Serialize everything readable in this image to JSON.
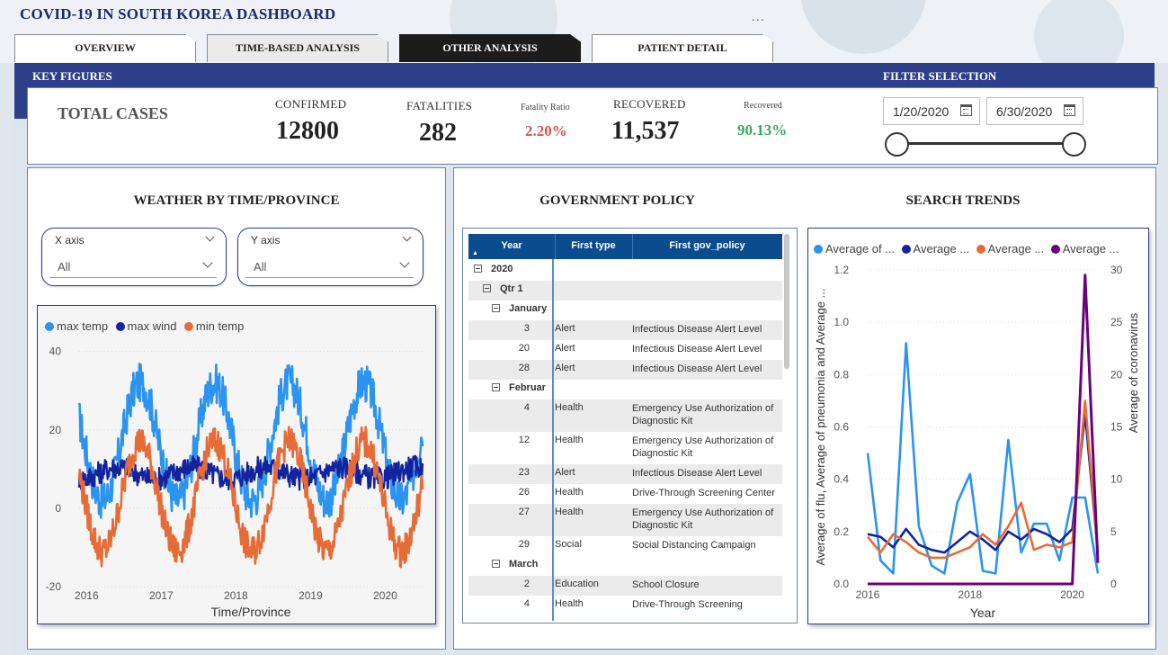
{
  "header": {
    "title": "COVID-19 IN SOUTH KOREA DASHBOARD",
    "more_label": "..."
  },
  "tabs": [
    {
      "label": "OVERVIEW"
    },
    {
      "label": "TIME-BASED ANALYSIS"
    },
    {
      "label": "OTHER ANALYSIS"
    },
    {
      "label": "PATIENT DETAIL"
    }
  ],
  "key_figures": {
    "section_label": "KEY FIGURES",
    "total_label": "TOTAL CASES",
    "confirmed_label": "CONFIRMED",
    "confirmed_value": "12800",
    "fatalities_label": "FATALITIES",
    "fatalities_value": "282",
    "fatality_ratio_label": "Fatality Ratio",
    "fatality_ratio_value": "2.20%",
    "recovered_label": "RECOVERED",
    "recovered_value": "11,537",
    "recovered_pct_label": "Recovered",
    "recovered_pct_value": "90.13%",
    "colors": {
      "fatality": "#d9534f",
      "recovered": "#3aaa5a"
    }
  },
  "filter": {
    "section_label": "FILTER SELECTION",
    "start_date": "1/20/2020",
    "end_date": "6/30/2020"
  },
  "weather": {
    "title": "WEATHER BY TIME/PROVINCE",
    "x_slicer": {
      "label": "X axis",
      "value": "All"
    },
    "y_slicer": {
      "label": "Y axis",
      "value": "All"
    },
    "legend": [
      {
        "name": "max temp",
        "color": "#2b93f0"
      },
      {
        "name": "max wind",
        "color": "#12239e"
      },
      {
        "name": "min temp",
        "color": "#e66c37"
      }
    ],
    "xlabel": "Time/Province"
  },
  "policy": {
    "title": "GOVERNMENT POLICY",
    "columns": [
      "Year",
      "First type",
      "First gov_policy"
    ],
    "year": "2020",
    "quarter": "Qtr 1",
    "rows": [
      {
        "kind": "month",
        "label": "January"
      },
      {
        "kind": "data",
        "day": "3",
        "type": "Alert",
        "policy": "Infectious Disease Alert Level"
      },
      {
        "kind": "data",
        "day": "20",
        "type": "Alert",
        "policy": "Infectious Disease Alert Level"
      },
      {
        "kind": "data",
        "day": "28",
        "type": "Alert",
        "policy": "Infectious Disease Alert Level"
      },
      {
        "kind": "month",
        "label": "Februar"
      },
      {
        "kind": "data",
        "day": "4",
        "type": "Health",
        "policy": "Emergency Use Authorization of Diagnostic Kit"
      },
      {
        "kind": "data",
        "day": "12",
        "type": "Health",
        "policy": "Emergency Use Authorization of Diagnostic Kit"
      },
      {
        "kind": "data",
        "day": "23",
        "type": "Alert",
        "policy": "Infectious Disease Alert Level"
      },
      {
        "kind": "data",
        "day": "26",
        "type": "Health",
        "policy": "Drive-Through Screening Center"
      },
      {
        "kind": "data",
        "day": "27",
        "type": "Health",
        "policy": "Emergency Use Authorization of Diagnostic Kit"
      },
      {
        "kind": "data",
        "day": "29",
        "type": "Social",
        "policy": "Social Distancing Campaign"
      },
      {
        "kind": "month",
        "label": "March"
      },
      {
        "kind": "data",
        "day": "2",
        "type": "Education",
        "policy": "School Closure"
      },
      {
        "kind": "data",
        "day": "4",
        "type": "Health",
        "policy": "Drive-Through Screening"
      }
    ]
  },
  "search": {
    "title": "SEARCH TRENDS",
    "legend": [
      {
        "name": "Average of ...",
        "color": "#2b93f0"
      },
      {
        "name": "Average ...",
        "color": "#12239e"
      },
      {
        "name": "Average ...",
        "color": "#e66c37"
      },
      {
        "name": "Average ...",
        "color": "#6b007b"
      }
    ]
  },
  "chart_data": [
    {
      "type": "line",
      "title": "",
      "xlabel": "Time/Province",
      "ylabel": "",
      "x_ticks": [
        "2016",
        "2017",
        "2018",
        "2019",
        "2020"
      ],
      "y_ticks": [
        -20,
        0,
        20,
        40
      ],
      "ylim": [
        -20,
        42
      ],
      "legend_position": "top-left",
      "series": [
        {
          "name": "max temp",
          "color": "#2b93f0",
          "baseline": 17,
          "amplitude": 15,
          "noise": 5
        },
        {
          "name": "max wind",
          "color": "#12239e",
          "baseline": 9,
          "amplitude": 1.5,
          "noise": 3
        },
        {
          "name": "min temp",
          "color": "#e66c37",
          "baseline": 3,
          "amplitude": 14,
          "noise": 4
        }
      ],
      "x_range": [
        2015.9,
        2020.5
      ]
    },
    {
      "type": "line",
      "title": "",
      "xlabel": "Year",
      "ylabel": "Average of flu, Average of pneumonia and Average ...",
      "y2label": "Average of coronavirus",
      "x_ticks": [
        "2016",
        "2018",
        "2020"
      ],
      "y_ticks": [
        0.0,
        0.2,
        0.4,
        0.6,
        0.8,
        1.0,
        1.2
      ],
      "y2_ticks": [
        0,
        5,
        10,
        15,
        20,
        25,
        30
      ],
      "ylim": [
        0,
        1.2
      ],
      "y2lim": [
        0,
        30
      ],
      "x": [
        2016.0,
        2016.25,
        2016.5,
        2016.75,
        2017.0,
        2017.25,
        2017.5,
        2017.75,
        2018.0,
        2018.25,
        2018.5,
        2018.75,
        2019.0,
        2019.25,
        2019.5,
        2019.75,
        2020.0,
        2020.25
      ],
      "series": [
        {
          "name": "Average of flu",
          "color": "#2b93f0",
          "axis": "left",
          "values": [
            0.5,
            0.09,
            0.04,
            0.92,
            0.22,
            0.07,
            0.04,
            0.31,
            0.42,
            0.05,
            0.04,
            0.55,
            0.12,
            0.23,
            0.23,
            0.09,
            0.33,
            0.33,
            0.04
          ]
        },
        {
          "name": "Average of pneumonia",
          "color": "#12239e",
          "axis": "left",
          "values": [
            0.19,
            0.18,
            0.14,
            0.21,
            0.15,
            0.13,
            0.12,
            0.16,
            0.2,
            0.17,
            0.13,
            0.2,
            0.17,
            0.21,
            0.19,
            0.16,
            0.21,
            0.65,
            0.12
          ]
        },
        {
          "name": "Average",
          "color": "#e66c37",
          "axis": "left",
          "values": [
            0.18,
            0.12,
            0.19,
            0.16,
            0.12,
            0.1,
            0.1,
            0.12,
            0.14,
            0.19,
            0.15,
            0.22,
            0.31,
            0.13,
            0.15,
            0.14,
            0.16,
            0.7,
            0.12
          ]
        },
        {
          "name": "Average of coronavirus",
          "color": "#6b007b",
          "axis": "right",
          "values": [
            0,
            0,
            0,
            0,
            0,
            0,
            0,
            0,
            0,
            0,
            0,
            0,
            0,
            0,
            0,
            0,
            0,
            29.5,
            2
          ]
        }
      ]
    }
  ]
}
